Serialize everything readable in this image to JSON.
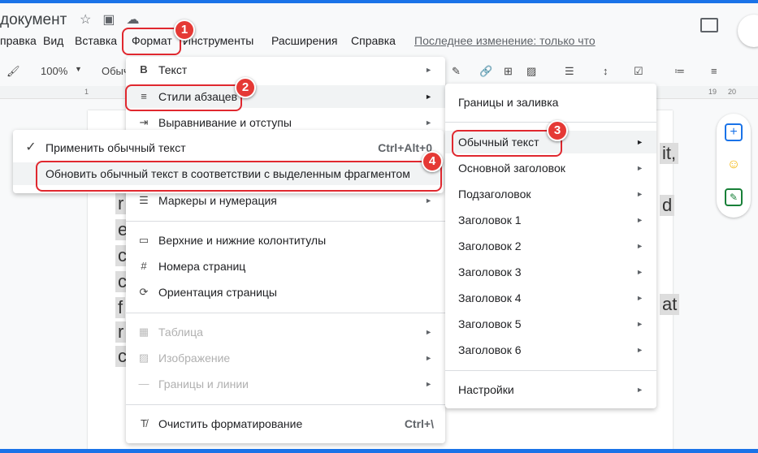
{
  "header": {
    "title": "документ",
    "last_edit": "Последнее изменение: только что"
  },
  "menubar": [
    "правка",
    "Вид",
    "Вставка",
    "Формат",
    "Инструменты",
    "Расширения",
    "Справка"
  ],
  "toolbar": {
    "zoom": "100%",
    "style_text": "Обыч"
  },
  "ruler": {
    "ticks": [
      "1",
      "19",
      "20"
    ]
  },
  "doc_fragments": [
    "it,",
    "d",
    "at",
    "r",
    "e",
    "c",
    "c",
    "f",
    "r",
    "c"
  ],
  "format_menu": {
    "items": [
      {
        "icon": "bold-icon",
        "label": "Текст"
      },
      {
        "icon": "paragraph-styles-icon",
        "label": "Стили абзацев"
      },
      {
        "icon": "indent-icon",
        "label": "Выравнивание и отступы"
      },
      {
        "icon": "list-icon",
        "label": "Маркеры и нумерация"
      },
      {
        "icon": "header-footer-icon",
        "label": "Верхние и нижние колонтитулы"
      },
      {
        "icon": "hash-icon",
        "label": "Номера страниц"
      },
      {
        "icon": "rotate-page-icon",
        "label": "Ориентация страницы"
      },
      {
        "icon": "table-icon",
        "label": "Таблица"
      },
      {
        "icon": "image-icon",
        "label": "Изображение"
      },
      {
        "icon": "line-icon",
        "label": "Границы и линии"
      },
      {
        "icon": "clear-format-icon",
        "label": "Очистить форматирование",
        "shortcut": "Ctrl+\\"
      }
    ]
  },
  "normal_text_menu": {
    "items": [
      {
        "label": "Применить обычный текст",
        "shortcut": "Ctrl+Alt+0"
      },
      {
        "label": "Обновить обычный текст в соответствии с выделенным фрагментом"
      }
    ]
  },
  "styles_menu": {
    "items": [
      "Границы и заливка",
      "Обычный текст",
      "Основной заголовок",
      "Подзаголовок",
      "Заголовок 1",
      "Заголовок 2",
      "Заголовок 3",
      "Заголовок 4",
      "Заголовок 5",
      "Заголовок 6",
      "Настройки"
    ]
  },
  "badges": [
    "1",
    "2",
    "3",
    "4"
  ],
  "colors": {
    "accent": "#1a73e8",
    "highlight": "#e0282f"
  }
}
